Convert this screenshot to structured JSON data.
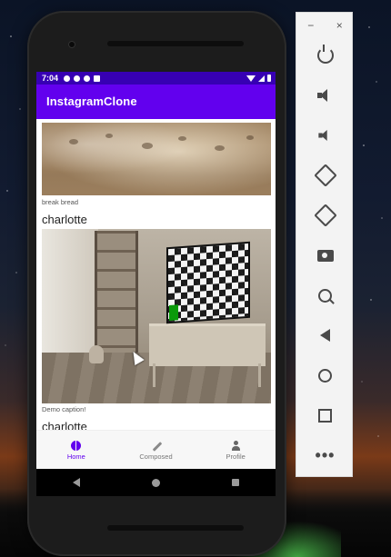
{
  "statusbar": {
    "time": "7:04"
  },
  "appbar": {
    "title": "InstagramClone"
  },
  "feed": {
    "posts": [
      {
        "caption": "break bread",
        "username": "charlotte"
      },
      {
        "caption": "Demo caption!",
        "username": "charlotte"
      }
    ]
  },
  "bottom_nav": {
    "items": [
      {
        "label": "Home",
        "icon": "home-icon",
        "active": true
      },
      {
        "label": "Composed",
        "icon": "pencil-icon",
        "active": false
      },
      {
        "label": "Profile",
        "icon": "person-icon",
        "active": false
      }
    ]
  },
  "emulator_toolbar": {
    "window_buttons": [
      "−",
      "×"
    ],
    "buttons": [
      "power-icon",
      "volume-up-icon",
      "volume-down-icon",
      "rotate-left-icon",
      "rotate-right-icon",
      "camera-icon",
      "zoom-icon",
      "back-icon",
      "home-icon",
      "overview-icon",
      "more-icon"
    ]
  },
  "colors": {
    "status_bar": "#3700b3",
    "app_bar": "#6200ee",
    "nav_active": "#6200ee",
    "tv_green": "#0a9a0a"
  }
}
